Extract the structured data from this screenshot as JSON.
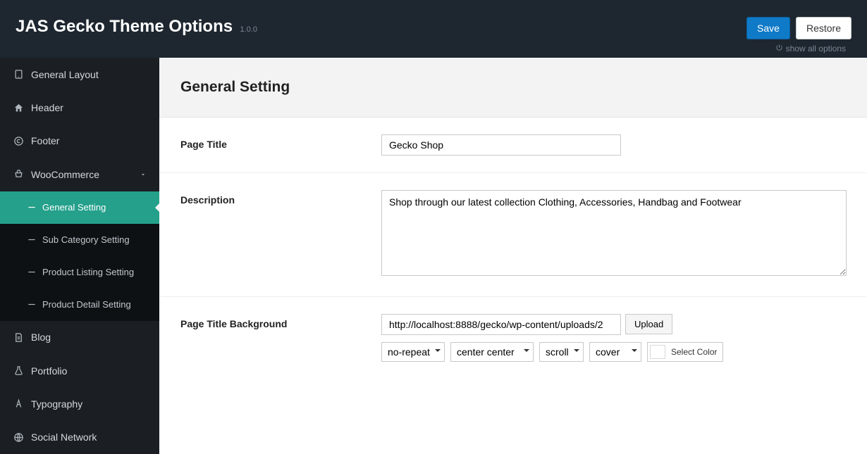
{
  "header": {
    "title": "JAS Gecko Theme Options",
    "version": "1.0.0",
    "saveLabel": "Save",
    "restoreLabel": "Restore",
    "showAllLabel": "show all options"
  },
  "sidebar": {
    "items": [
      {
        "label": "General Layout",
        "iconName": "tablet-icon"
      },
      {
        "label": "Header",
        "iconName": "home-icon"
      },
      {
        "label": "Footer",
        "iconName": "copyright-icon"
      },
      {
        "label": "WooCommerce",
        "iconName": "basket-icon",
        "hasChildren": true
      },
      {
        "label": "Blog",
        "iconName": "document-icon"
      },
      {
        "label": "Portfolio",
        "iconName": "flask-icon"
      },
      {
        "label": "Typography",
        "iconName": "font-icon"
      },
      {
        "label": "Social Network",
        "iconName": "globe-icon"
      }
    ],
    "wooChildren": [
      {
        "label": "General Setting",
        "active": true
      },
      {
        "label": "Sub Category Setting"
      },
      {
        "label": "Product Listing Setting"
      },
      {
        "label": "Product Detail Setting"
      }
    ]
  },
  "panel": {
    "title": "General Setting",
    "fields": {
      "pageTitle": {
        "label": "Page Title",
        "value": "Gecko Shop"
      },
      "description": {
        "label": "Description",
        "value": "Shop through our latest collection Clothing, Accessories, Handbag and Footwear"
      },
      "background": {
        "label": "Page Title Background",
        "url": "http://localhost:8888/gecko/wp-content/uploads/2",
        "uploadLabel": "Upload",
        "repeat": "no-repeat",
        "position": "center center",
        "attachment": "scroll",
        "size": "cover",
        "selectColorLabel": "Select Color"
      }
    }
  }
}
